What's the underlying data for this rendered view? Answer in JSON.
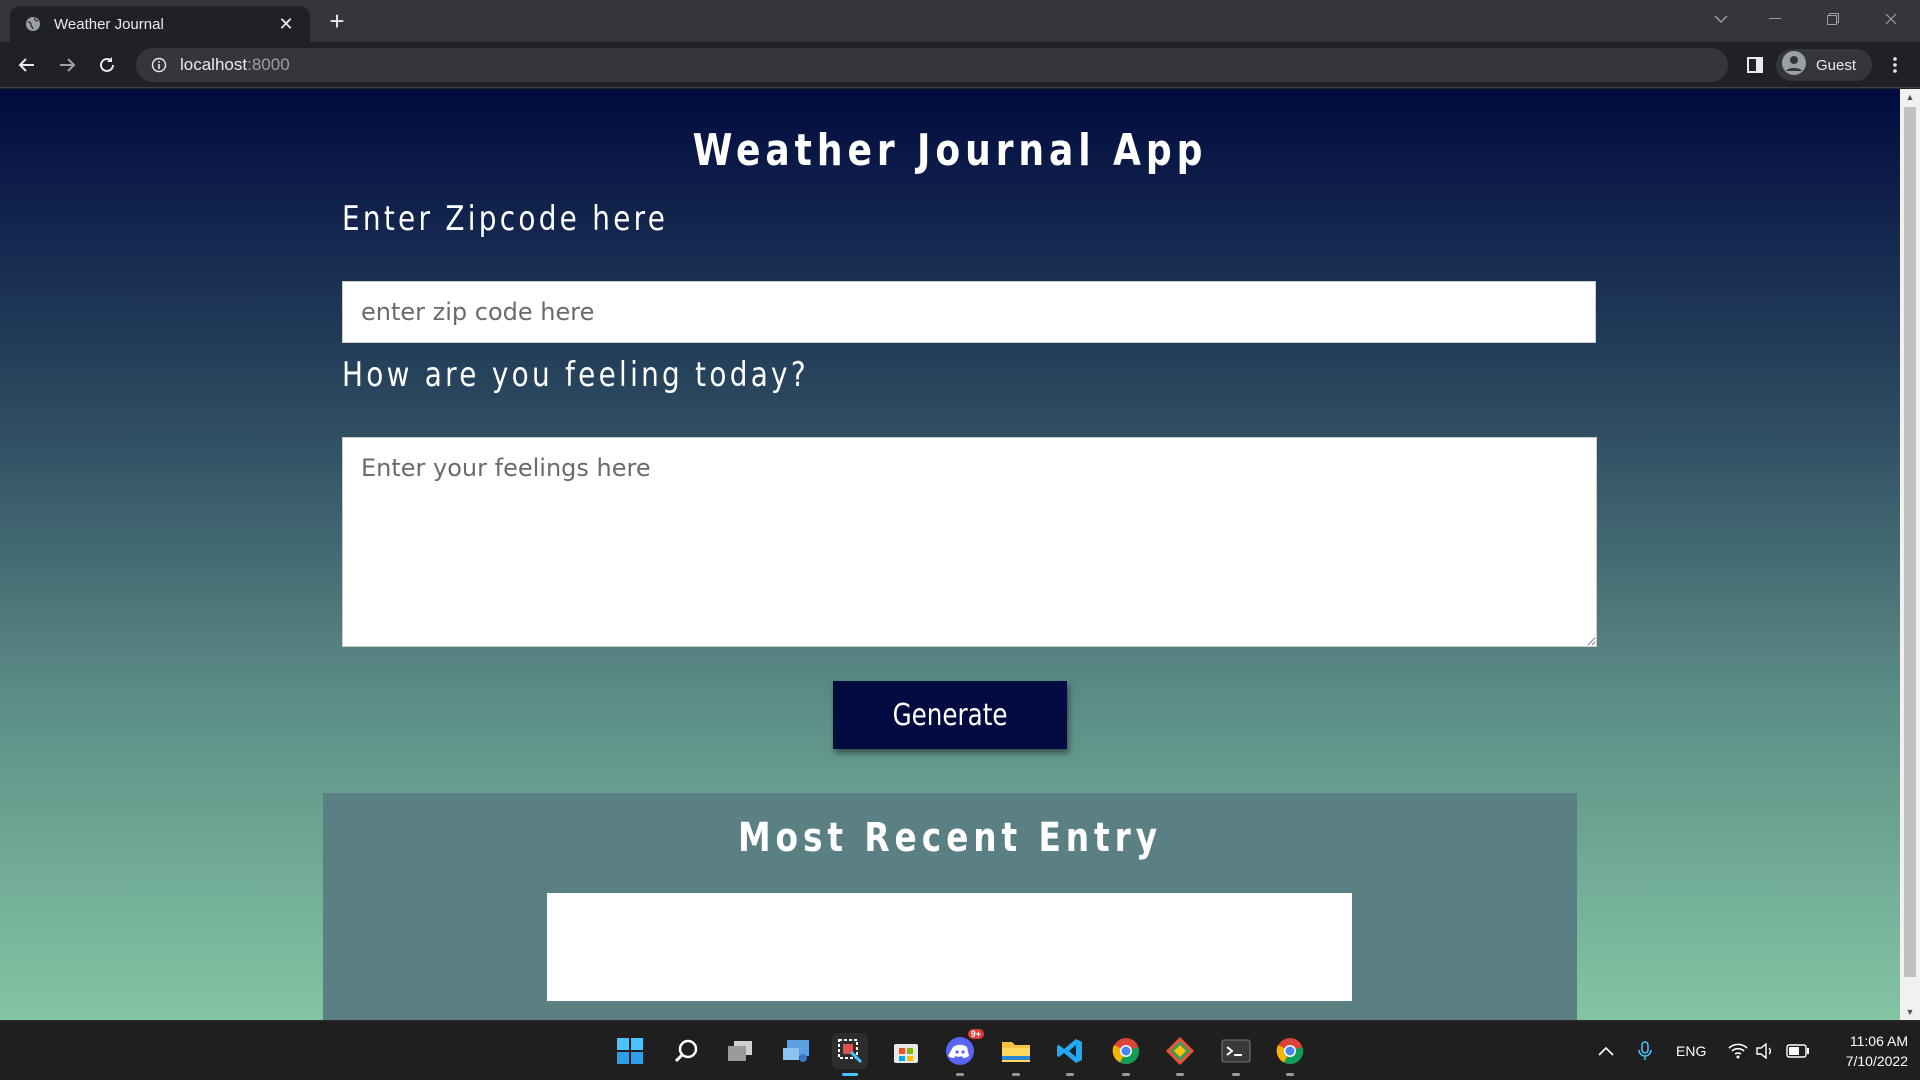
{
  "browser": {
    "tab_title": "Weather Journal",
    "url_host": "localhost",
    "url_port": ":8000",
    "profile_label": "Guest"
  },
  "page": {
    "title": "Weather Journal App",
    "zip_label": "Enter Zipcode here",
    "zip_placeholder": "enter zip code here",
    "feelings_label": "How are you feeling today?",
    "feelings_placeholder": "Enter your feelings here",
    "generate_label": "Generate",
    "recent_entry_title": "Most Recent Entry"
  },
  "taskbar": {
    "apps": [
      {
        "name": "start-icon"
      },
      {
        "name": "search-icon"
      },
      {
        "name": "task-view-icon"
      },
      {
        "name": "widgets-icon"
      },
      {
        "name": "snipping-tool-icon"
      },
      {
        "name": "microsoft-store-icon"
      },
      {
        "name": "discord-icon",
        "badge": "9+"
      },
      {
        "name": "file-explorer-icon"
      },
      {
        "name": "vscode-icon"
      },
      {
        "name": "chrome-icon"
      },
      {
        "name": "git-icon"
      },
      {
        "name": "terminal-icon"
      },
      {
        "name": "chrome-guest-icon"
      }
    ],
    "language": "ENG",
    "time": "11:06 AM",
    "date": "7/10/2022"
  },
  "colors": {
    "gradient_top": "#010b3f",
    "gradient_bottom": "#84c5a4",
    "button_bg": "#010b3f",
    "panel_bg": "#5a8083"
  }
}
